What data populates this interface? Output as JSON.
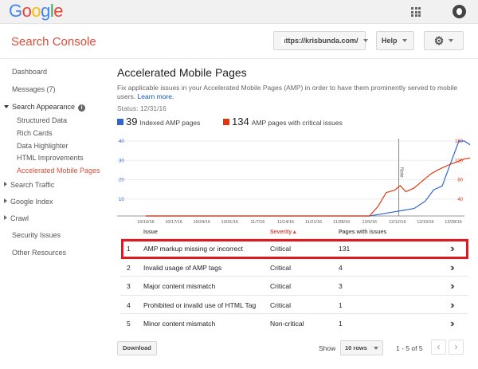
{
  "logo": {
    "text": "Google",
    "colors": [
      "#4285f4",
      "#ea4335",
      "#fbbc05",
      "#4285f4",
      "#34a853",
      "#ea4335"
    ]
  },
  "header": {
    "product": "Search Console",
    "site": "https://krisbunda.com/",
    "help": "Help"
  },
  "sidebar": {
    "dashboard": "Dashboard",
    "messages": "Messages (7)",
    "search_appearance": "Search Appearance",
    "sub": [
      "Structured Data",
      "Rich Cards",
      "Data Highlighter",
      "HTML Improvements",
      "Accelerated Mobile Pages"
    ],
    "search_traffic": "Search Traffic",
    "google_index": "Google Index",
    "crawl": "Crawl",
    "security": "Security Issues",
    "other": "Other Resources"
  },
  "main": {
    "title": "Accelerated Mobile Pages",
    "description": "Fix applicable issues in your Accelerated Mobile Pages (AMP) in order to have them prominently served to mobile users.",
    "learn_more": "Learn more.",
    "status": "Status: 12/31/16",
    "kpi_indexed": {
      "value": "39",
      "label": "Indexed AMP pages",
      "color": "#3366cc"
    },
    "kpi_critical": {
      "value": "134",
      "label": "AMP pages with critical issues",
      "color": "#dc3912"
    }
  },
  "chart_data": {
    "type": "line",
    "x": [
      "10/10/16",
      "10/17/16",
      "10/24/16",
      "10/31/16",
      "11/7/16",
      "11/14/16",
      "11/21/16",
      "11/28/16",
      "12/5/16",
      "12/12/16",
      "12/19/16",
      "12/28/16"
    ],
    "left_ticks": [
      "40",
      "30",
      "20",
      "10"
    ],
    "right_ticks": [
      "160",
      "120",
      "80",
      "40"
    ],
    "annotation": "Note",
    "series": [
      {
        "axis": "left",
        "color": "#3366cc",
        "points": [
          [
            0,
            0
          ],
          [
            8,
            0
          ],
          [
            8.4,
            1
          ],
          [
            8.8,
            2
          ],
          [
            9.2,
            3
          ],
          [
            9.6,
            4
          ],
          [
            10,
            8
          ],
          [
            10.3,
            14
          ],
          [
            10.6,
            16
          ],
          [
            10.9,
            28
          ],
          [
            11.2,
            40
          ],
          [
            11.4,
            40
          ],
          [
            11.6,
            38
          ]
        ]
      },
      {
        "axis": "right",
        "color": "#dc3912",
        "points": [
          [
            0,
            0
          ],
          [
            8,
            0
          ],
          [
            8.3,
            20
          ],
          [
            8.6,
            50
          ],
          [
            8.9,
            55
          ],
          [
            9.1,
            65
          ],
          [
            9.3,
            52
          ],
          [
            9.6,
            60
          ],
          [
            9.9,
            75
          ],
          [
            10.2,
            90
          ],
          [
            10.5,
            100
          ],
          [
            10.8,
            108
          ],
          [
            11.1,
            115
          ],
          [
            11.4,
            122
          ],
          [
            11.7,
            125
          ]
        ]
      }
    ]
  },
  "table": {
    "headers": {
      "issue": "Issue",
      "severity": "Severity",
      "sort_arrow": "▲",
      "pages": "Pages with issues"
    },
    "rows": [
      {
        "n": "1",
        "issue": "AMP markup missing or incorrect",
        "severity": "Critical",
        "pages": "131"
      },
      {
        "n": "2",
        "issue": "Invalid usage of AMP tags",
        "severity": "Critical",
        "pages": "4"
      },
      {
        "n": "3",
        "issue": "Major content mismatch",
        "severity": "Critical",
        "pages": "3"
      },
      {
        "n": "4",
        "issue": "Prohibited or invalid use of HTML Tag",
        "severity": "Critical",
        "pages": "1"
      },
      {
        "n": "5",
        "issue": "Minor content mismatch",
        "severity": "Non-critical",
        "pages": "1"
      }
    ]
  },
  "footer": {
    "download": "Download",
    "show": "Show",
    "rows": "10 rows",
    "range": "1 - 5 of 5",
    "prev": "‹",
    "next": "›"
  }
}
